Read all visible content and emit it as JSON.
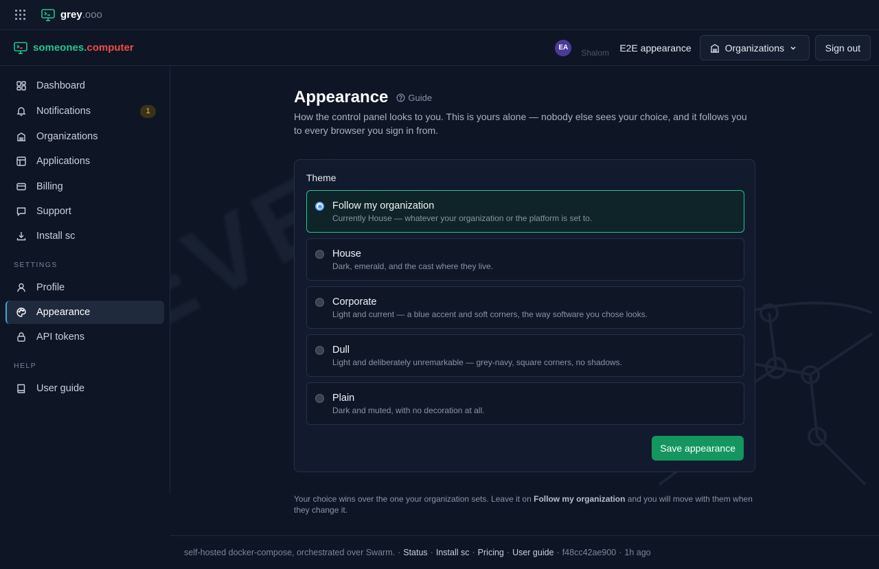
{
  "topbar": {
    "brand_name": "grey",
    "brand_ext": ".ooo"
  },
  "app": {
    "brand_part1": "someones",
    "brand_dot": ".",
    "brand_part2": "computer"
  },
  "header": {
    "avatar_initials": "EA",
    "user_subtitle": "Shalom",
    "user_name": "E2E appearance",
    "organizations_label": "Organizations",
    "signout_label": "Sign out"
  },
  "sidebar": {
    "items": [
      {
        "label": "Dashboard"
      },
      {
        "label": "Notifications",
        "badge": "1"
      },
      {
        "label": "Organizations"
      },
      {
        "label": "Applications"
      },
      {
        "label": "Billing"
      },
      {
        "label": "Support"
      },
      {
        "label": "Install sc"
      }
    ],
    "settings_label": "SETTINGS",
    "settings_items": [
      {
        "label": "Profile"
      },
      {
        "label": "Appearance",
        "active": true
      },
      {
        "label": "API tokens"
      }
    ],
    "help_label": "HELP",
    "help_items": [
      {
        "label": "User guide"
      }
    ]
  },
  "watermark": {
    "text": "DEVEL"
  },
  "main": {
    "title": "Appearance",
    "guide_label": "Guide",
    "description": "How the control panel looks to you. This is yours alone — nobody else sees your choice, and it follows you to every browser you sign in from.",
    "theme_label": "Theme",
    "options": [
      {
        "title": "Follow my organization",
        "desc": "Currently House — whatever your organization or the platform is set to.",
        "selected": true
      },
      {
        "title": "House",
        "desc": "Dark, emerald, and the cast where they live."
      },
      {
        "title": "Corporate",
        "desc": "Light and current — a blue accent and soft corners, the way software you chose looks."
      },
      {
        "title": "Dull",
        "desc": "Light and deliberately unremarkable — grey-navy, square corners, no shadows."
      },
      {
        "title": "Plain",
        "desc": "Dark and muted, with no decoration at all."
      }
    ],
    "save_label": "Save appearance",
    "note_before": "Your choice wins over the one your organization sets. Leave it on ",
    "note_bold": "Follow my organization",
    "note_after": " and you will move with them when they change it."
  },
  "footer": {
    "text": "self-hosted docker-compose, orchestrated over Swarm.",
    "links": [
      "Status",
      "Install sc",
      "Pricing",
      "User guide"
    ],
    "commit": "f48cc42ae900",
    "age": "1h ago"
  },
  "colors": {
    "accent": "#22c58b",
    "danger": "#ef4b4b",
    "primary_button": "#14965f",
    "background": "#0e1525"
  }
}
